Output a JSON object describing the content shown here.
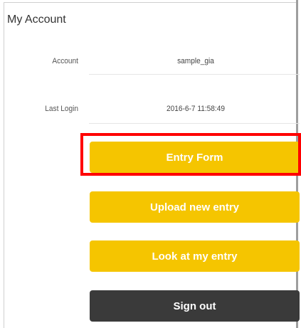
{
  "account_panel": {
    "title": "My Account",
    "rows": [
      {
        "label": "Account",
        "value": "sample_gia"
      },
      {
        "label": "Last Login",
        "value": "2016-6-7 11:58:49"
      }
    ]
  },
  "buttons": {
    "entry_form": "Entry Form",
    "upload_new_entry": "Upload new entry",
    "look_at_my_entry": "Look at my entry",
    "sign_out": "Sign out"
  },
  "colors": {
    "accent": "#f5c500",
    "dark_button": "#3a3a3a",
    "highlight": "#ff0000"
  }
}
